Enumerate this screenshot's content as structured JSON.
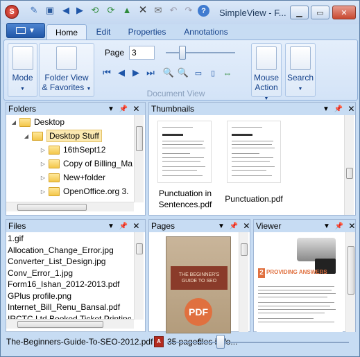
{
  "window": {
    "title": "SimpleView - F..."
  },
  "tabs": [
    "Home",
    "Edit",
    "Properties",
    "Annotations"
  ],
  "ribbon": {
    "mode_label": "Mode",
    "folder_view_label_1": "Folder View",
    "folder_view_label_2": "& Favorites",
    "page_label": "Page",
    "page_value": "3",
    "group_label": "Document View",
    "mouse_action_1": "Mouse",
    "mouse_action_2": "Action",
    "search_label": "Search"
  },
  "panels": {
    "folders": {
      "title": "Folders",
      "items": [
        "Desktop",
        "Desktop Stuff",
        "16thSept12",
        "Copy of Billing_Ma",
        "New+folder",
        "OpenOffice.org 3."
      ]
    },
    "thumbnails": {
      "title": "Thumbnails",
      "items": [
        {
          "caption_1": "Punctuation in",
          "caption_2": "Sentences.pdf"
        },
        {
          "caption_1": "Punctuation.pdf",
          "caption_2": ""
        }
      ]
    },
    "files": {
      "title": "Files",
      "items": [
        "1.gif",
        "Allocation_Change_Error.jpg",
        "Converter_List_Design.jpg",
        "Conv_Error_1.jpg",
        "Form16_Ishan_2012-2013.pdf",
        "GPlus profile.png",
        "Internet_Bill_Renu_Bansal.pdf",
        "IRCTC Ltd Booked Ticket Printing"
      ]
    },
    "pages": {
      "title": "Pages",
      "cover_line_1": "THE BEGINNER'S",
      "cover_line_2": "GUIDE TO SEO",
      "cover_badge": "PDF"
    },
    "viewer": {
      "title": "Viewer",
      "heading": "PROVIDING ANSWERS"
    }
  },
  "status": {
    "filename": "The-Beginners-Guide-To-SEO-2012.pdf",
    "pages_text": "35 pages",
    "files_text": "files in fo..."
  },
  "colors": {
    "chrome": "#c7dcf3",
    "accent": "#1f56a8",
    "close": "#c8482f",
    "cover_orange": "#e0703f"
  }
}
